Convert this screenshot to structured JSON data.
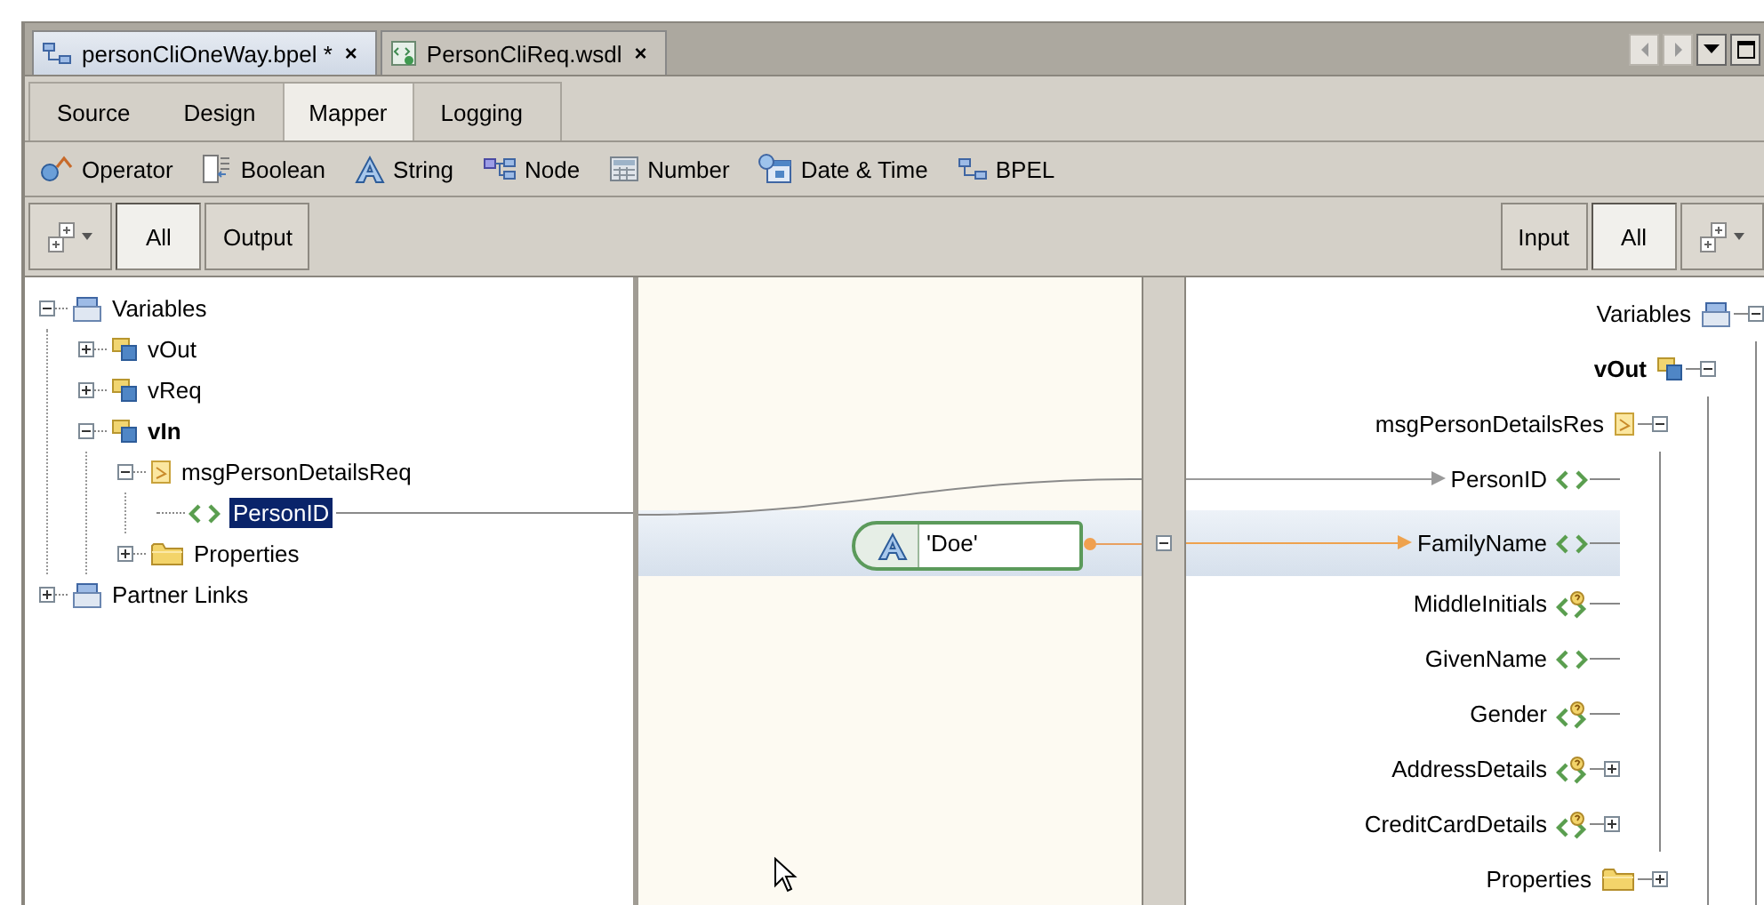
{
  "file_tabs": [
    {
      "label": "personCliOneWay.bpel *",
      "close": "×",
      "kind": "bpel",
      "selected": true
    },
    {
      "label": "PersonCliReq.wsdl",
      "close": "×",
      "kind": "wsdl",
      "selected": false
    }
  ],
  "view_tabs": [
    {
      "label": "Source",
      "selected": false
    },
    {
      "label": "Design",
      "selected": false
    },
    {
      "label": "Mapper",
      "selected": true
    },
    {
      "label": "Logging",
      "selected": false
    }
  ],
  "palette": [
    {
      "label": "Operator",
      "kind": "operator"
    },
    {
      "label": "Boolean",
      "kind": "boolean"
    },
    {
      "label": "String",
      "kind": "string"
    },
    {
      "label": "Node",
      "kind": "node"
    },
    {
      "label": "Number",
      "kind": "number"
    },
    {
      "label": "Date & Time",
      "kind": "datetime"
    },
    {
      "label": "BPEL",
      "kind": "bpel"
    }
  ],
  "output_filter": [
    {
      "label": "All",
      "selected": true
    },
    {
      "label": "Output",
      "selected": false
    }
  ],
  "input_filter": [
    {
      "label": "Input",
      "selected": false
    },
    {
      "label": "All",
      "selected": true
    }
  ],
  "source_tree": [
    {
      "label": "Variables",
      "kind": "root",
      "expanded": true,
      "bold": false,
      "selected": false,
      "children": [
        {
          "label": "vOut",
          "kind": "variable",
          "expanded": false,
          "bold": false,
          "selected": false
        },
        {
          "label": "vReq",
          "kind": "variable",
          "expanded": false,
          "bold": false,
          "selected": false
        },
        {
          "label": "vIn",
          "kind": "variable",
          "expanded": true,
          "bold": true,
          "selected": false,
          "children": [
            {
              "label": "msgPersonDetailsReq",
              "kind": "message",
              "expanded": true,
              "bold": false,
              "selected": false,
              "children": [
                {
                  "label": "PersonID",
                  "kind": "element",
                  "bold": false,
                  "selected": true,
                  "connected": true
                }
              ]
            },
            {
              "label": "Properties",
              "kind": "folder",
              "expanded": false,
              "bold": false,
              "selected": false
            }
          ]
        }
      ]
    },
    {
      "label": "Partner Links",
      "kind": "root",
      "expanded": false,
      "bold": false,
      "selected": false
    }
  ],
  "canvas": {
    "string_literal": {
      "value": "'Doe'"
    }
  },
  "target_tree": [
    {
      "label": "Variables",
      "kind": "root",
      "expanded": true,
      "bold": false,
      "selected": false,
      "children": [
        {
          "label": "vOut",
          "kind": "variable",
          "expanded": true,
          "bold": true,
          "selected": false,
          "children": [
            {
              "label": "msgPersonDetailsRes",
              "kind": "message",
              "expanded": true,
              "bold": false,
              "selected": false,
              "children": [
                {
                  "label": "PersonID",
                  "kind": "element",
                  "bold": false,
                  "selected": false,
                  "connected": true
                },
                {
                  "label": "FamilyName",
                  "kind": "element",
                  "bold": false,
                  "selected": true,
                  "connected": true
                },
                {
                  "label": "MiddleInitials",
                  "kind": "optional",
                  "bold": false,
                  "selected": false,
                  "connected": false
                },
                {
                  "label": "GivenName",
                  "kind": "element",
                  "bold": false,
                  "selected": false,
                  "connected": false
                },
                {
                  "label": "Gender",
                  "kind": "optional",
                  "bold": false,
                  "selected": false,
                  "connected": false
                },
                {
                  "label": "AddressDetails",
                  "kind": "optional",
                  "expanded": false,
                  "bold": false,
                  "selected": false,
                  "connected": false
                },
                {
                  "label": "CreditCardDetails",
                  "kind": "optional",
                  "expanded": false,
                  "bold": false,
                  "selected": false,
                  "connected": false
                }
              ]
            },
            {
              "label": "Properties",
              "kind": "folder",
              "expanded": false,
              "bold": false,
              "selected": false
            }
          ]
        }
      ]
    }
  ]
}
